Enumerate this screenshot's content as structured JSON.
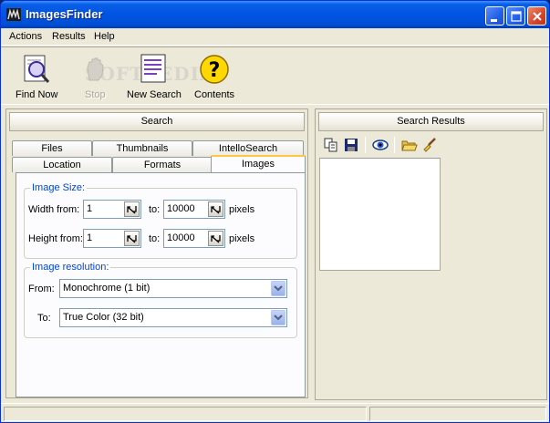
{
  "window": {
    "title": "ImagesFinder",
    "controls": [
      "minimize",
      "maximize",
      "close"
    ]
  },
  "menu": [
    {
      "label": "Actions"
    },
    {
      "label": "Results"
    },
    {
      "label": "Help"
    }
  ],
  "toolbar": {
    "find_now": "Find Now",
    "stop": "Stop",
    "new_search": "New Search",
    "contents": "Contents",
    "watermark": "SOFTPEDIA"
  },
  "search_panel": {
    "header": "Search",
    "tabs_row1": [
      "Files",
      "Thumbnails",
      "IntelloSearch"
    ],
    "tabs_row2": [
      "Location",
      "Formats",
      "Images"
    ],
    "active_tab": "Images",
    "image_size": {
      "title": "Image Size:",
      "width_from_label": "Width from:",
      "width_from": "1",
      "width_to_label": "to:",
      "width_to": "10000",
      "width_unit": "pixels",
      "height_from_label": "Height from:",
      "height_from": "1",
      "height_to_label": "to:",
      "height_to": "10000",
      "height_unit": "pixels"
    },
    "image_resolution": {
      "title": "Image resolution:",
      "from_label": "From:",
      "from_value": "Monochrome (1 bit)",
      "to_label": "To:",
      "to_value": "True Color (32 bit)"
    }
  },
  "results_panel": {
    "header": "Search Results",
    "icons": [
      "copy-icon",
      "save-icon",
      "view-icon",
      "open-folder-icon",
      "clear-icon"
    ]
  },
  "colors": {
    "titlebar": "#0054e3",
    "group_title": "#0046d5",
    "active_tab_accent": "#ffc83c"
  }
}
